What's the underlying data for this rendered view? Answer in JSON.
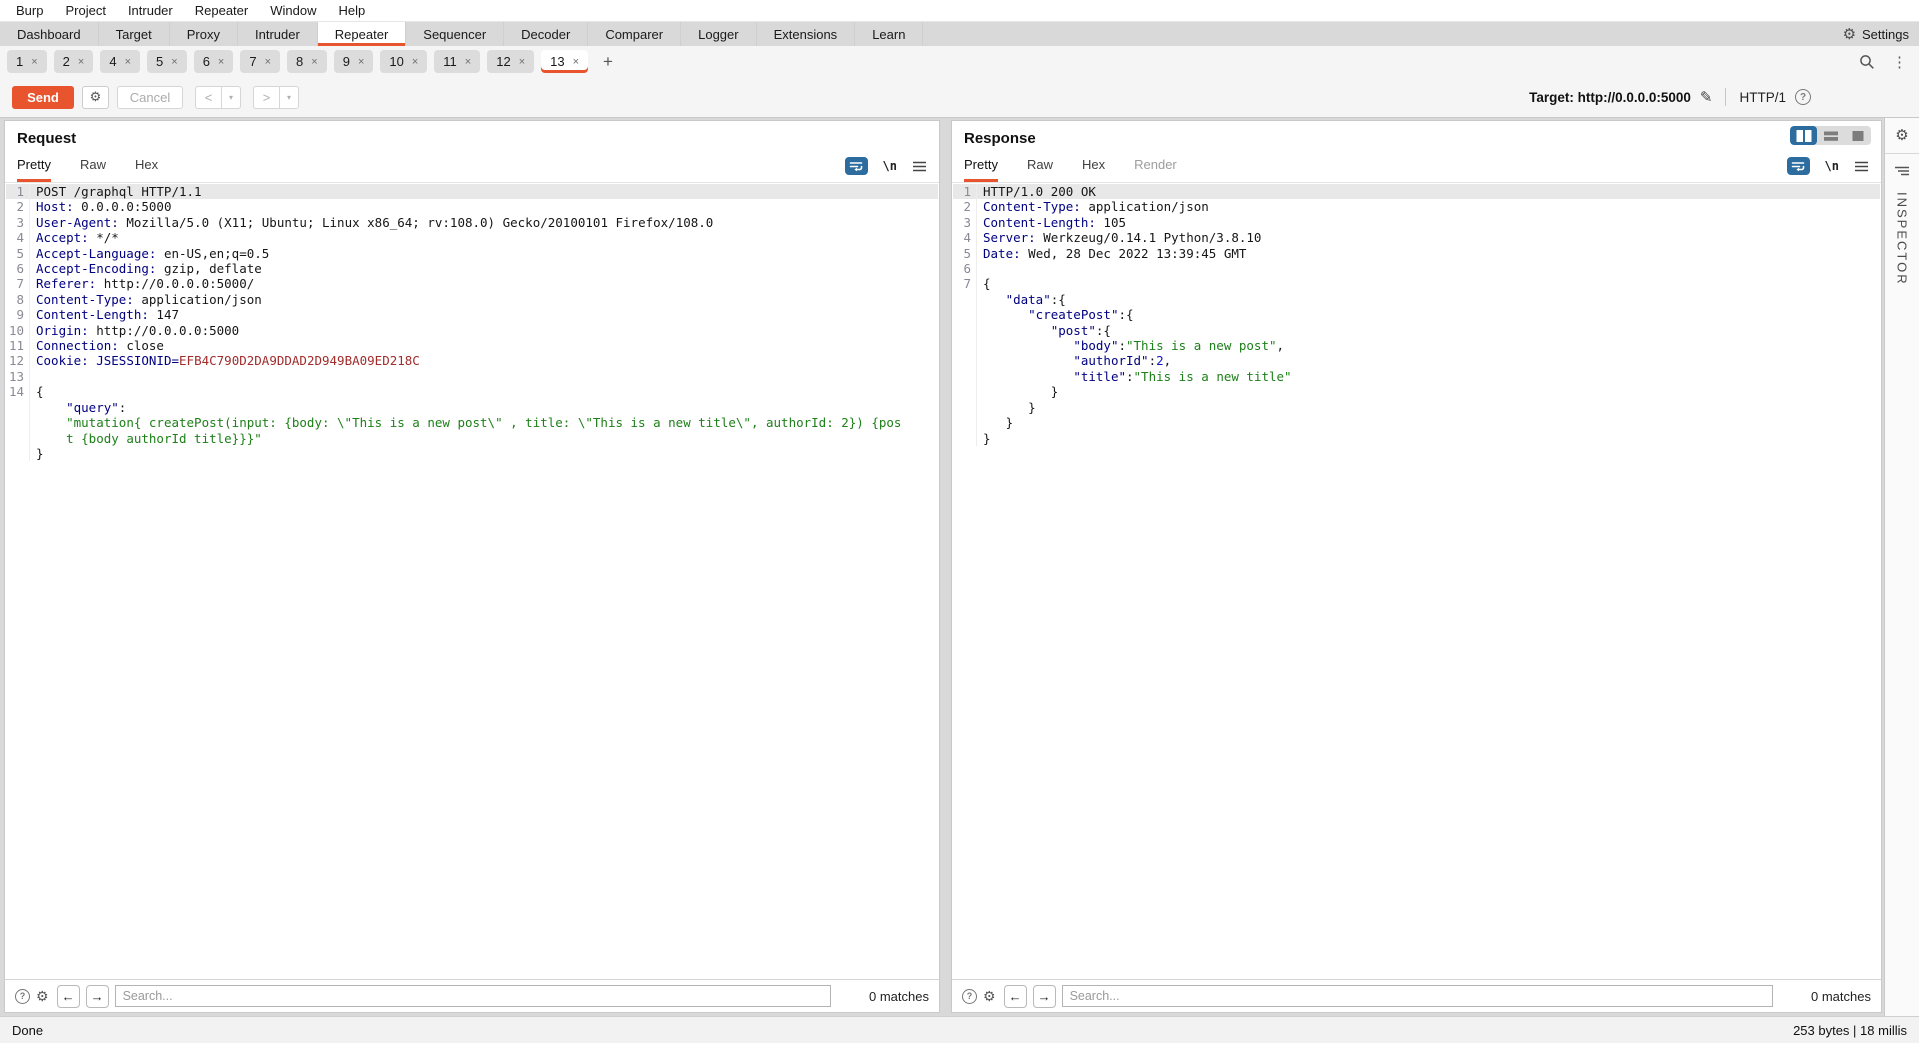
{
  "colors": {
    "accent": "#e8542d",
    "icon_blue": "#2d6c9e",
    "key_navy": "#000080",
    "string_green": "#1e8019",
    "number_blue": "#1313c8",
    "cookie_red": "#a12c2c"
  },
  "menu_bar": {
    "items": [
      "Burp",
      "Project",
      "Intruder",
      "Repeater",
      "Window",
      "Help"
    ]
  },
  "main_tabs": {
    "items": [
      "Dashboard",
      "Target",
      "Proxy",
      "Intruder",
      "Repeater",
      "Sequencer",
      "Decoder",
      "Comparer",
      "Logger",
      "Extensions",
      "Learn"
    ],
    "active": "Repeater",
    "settings_label": "Settings"
  },
  "repeater_tabs": {
    "items": [
      "1",
      "2",
      "4",
      "5",
      "6",
      "7",
      "8",
      "9",
      "10",
      "11",
      "12",
      "13"
    ],
    "active": "13",
    "close_glyph": "×",
    "add_label": "+"
  },
  "toolbar": {
    "send_label": "Send",
    "cancel_label": "Cancel",
    "prev_label": "<",
    "next_label": ">",
    "dropdown_glyph": "▾",
    "target_text": "Target: http://0.0.0.0:5000",
    "protocol_label": "HTTP/1",
    "help_glyph": "?"
  },
  "request": {
    "title": "Request",
    "tabs": [
      "Pretty",
      "Raw",
      "Hex"
    ],
    "active_tab": "Pretty",
    "disabled_tabs": [],
    "newline_icon_label": "\\n",
    "search_placeholder": "Search...",
    "matches_label": "0 matches",
    "lines": [
      {
        "n": "1",
        "sel": true,
        "s": [
          [
            "v",
            "POST /graphql HTTP/1.1"
          ]
        ]
      },
      {
        "n": "2",
        "s": [
          [
            "k",
            "Host:"
          ],
          [
            "v",
            " 0.0.0.0:5000"
          ]
        ]
      },
      {
        "n": "3",
        "s": [
          [
            "k",
            "User-Agent:"
          ],
          [
            "v",
            " Mozilla/5.0 (X11; Ubuntu; Linux x86_64; rv:108.0) Gecko/20100101 Firefox/108.0"
          ]
        ]
      },
      {
        "n": "4",
        "s": [
          [
            "k",
            "Accept:"
          ],
          [
            "v",
            " */*"
          ]
        ]
      },
      {
        "n": "5",
        "s": [
          [
            "k",
            "Accept-Language:"
          ],
          [
            "v",
            " en-US,en;q=0.5"
          ]
        ]
      },
      {
        "n": "6",
        "s": [
          [
            "k",
            "Accept-Encoding:"
          ],
          [
            "v",
            " gzip, deflate"
          ]
        ]
      },
      {
        "n": "7",
        "s": [
          [
            "k",
            "Referer:"
          ],
          [
            "v",
            " http://0.0.0.0:5000/"
          ]
        ]
      },
      {
        "n": "8",
        "s": [
          [
            "k",
            "Content-Type:"
          ],
          [
            "v",
            " application/json"
          ]
        ]
      },
      {
        "n": "9",
        "s": [
          [
            "k",
            "Content-Length:"
          ],
          [
            "v",
            " 147"
          ]
        ]
      },
      {
        "n": "10",
        "s": [
          [
            "k",
            "Origin:"
          ],
          [
            "v",
            " http://0.0.0.0:5000"
          ]
        ]
      },
      {
        "n": "11",
        "s": [
          [
            "k",
            "Connection:"
          ],
          [
            "v",
            " close"
          ]
        ]
      },
      {
        "n": "12",
        "s": [
          [
            "k",
            "Cookie:"
          ],
          [
            "v",
            " "
          ],
          [
            "k",
            "JSESSIONID="
          ],
          [
            "r",
            "EFB4C790D2DA9DDAD2D949BA09ED218C"
          ]
        ]
      },
      {
        "n": "13",
        "s": []
      },
      {
        "n": "14",
        "s": [
          [
            "v",
            "{"
          ]
        ]
      },
      {
        "n": null,
        "s": [
          [
            "v",
            "    "
          ],
          [
            "k",
            "\"query\""
          ],
          [
            "v",
            ":"
          ]
        ]
      },
      {
        "n": null,
        "s": [
          [
            "v",
            "    "
          ],
          [
            "s",
            "\"mutation{ createPost(input: {body: \\\"This is a new post\\\" , title: \\\"This is a new title\\\", authorId: 2}) {pos"
          ]
        ]
      },
      {
        "n": null,
        "s": [
          [
            "v",
            "    "
          ],
          [
            "s",
            "t {body authorId title}}}\""
          ]
        ]
      },
      {
        "n": null,
        "s": [
          [
            "v",
            "}"
          ]
        ]
      }
    ]
  },
  "response": {
    "title": "Response",
    "tabs": [
      "Pretty",
      "Raw",
      "Hex",
      "Render"
    ],
    "active_tab": "Pretty",
    "disabled_tabs": [
      "Render"
    ],
    "newline_icon_label": "\\n",
    "search_placeholder": "Search...",
    "matches_label": "0 matches",
    "lines": [
      {
        "n": "1",
        "sel": true,
        "s": [
          [
            "v",
            "HTTP/1.0 200 OK"
          ]
        ]
      },
      {
        "n": "2",
        "s": [
          [
            "k",
            "Content-Type:"
          ],
          [
            "v",
            " application/json"
          ]
        ]
      },
      {
        "n": "3",
        "s": [
          [
            "k",
            "Content-Length:"
          ],
          [
            "v",
            " 105"
          ]
        ]
      },
      {
        "n": "4",
        "s": [
          [
            "k",
            "Server:"
          ],
          [
            "v",
            " Werkzeug/0.14.1 Python/3.8.10"
          ]
        ]
      },
      {
        "n": "5",
        "s": [
          [
            "k",
            "Date:"
          ],
          [
            "v",
            " Wed, 28 Dec 2022 13:39:45 GMT"
          ]
        ]
      },
      {
        "n": "6",
        "s": []
      },
      {
        "n": "7",
        "s": [
          [
            "v",
            "{"
          ]
        ]
      },
      {
        "n": null,
        "s": [
          [
            "v",
            "   "
          ],
          [
            "k",
            "\"data\""
          ],
          [
            "v",
            ":{"
          ]
        ]
      },
      {
        "n": null,
        "s": [
          [
            "v",
            "      "
          ],
          [
            "k",
            "\"createPost\""
          ],
          [
            "v",
            ":{"
          ]
        ]
      },
      {
        "n": null,
        "s": [
          [
            "v",
            "         "
          ],
          [
            "k",
            "\"post\""
          ],
          [
            "v",
            ":{"
          ]
        ]
      },
      {
        "n": null,
        "s": [
          [
            "v",
            "            "
          ],
          [
            "k",
            "\"body\""
          ],
          [
            "v",
            ":"
          ],
          [
            "s",
            "\"This is a new post\""
          ],
          [
            "v",
            ","
          ]
        ]
      },
      {
        "n": null,
        "s": [
          [
            "v",
            "            "
          ],
          [
            "k",
            "\"authorId\""
          ],
          [
            "v",
            ":"
          ],
          [
            "n2",
            "2"
          ],
          [
            "v",
            ","
          ]
        ]
      },
      {
        "n": null,
        "s": [
          [
            "v",
            "            "
          ],
          [
            "k",
            "\"title\""
          ],
          [
            "v",
            ":"
          ],
          [
            "s",
            "\"This is a new title\""
          ]
        ]
      },
      {
        "n": null,
        "s": [
          [
            "v",
            "         }"
          ]
        ]
      },
      {
        "n": null,
        "s": [
          [
            "v",
            "      }"
          ]
        ]
      },
      {
        "n": null,
        "s": [
          [
            "v",
            "   }"
          ]
        ]
      },
      {
        "n": null,
        "s": [
          [
            "v",
            "}"
          ]
        ]
      }
    ]
  },
  "inspector": {
    "label": "INSPECTOR"
  },
  "status_bar": {
    "left": "Done",
    "right": "253 bytes | 18 millis"
  }
}
